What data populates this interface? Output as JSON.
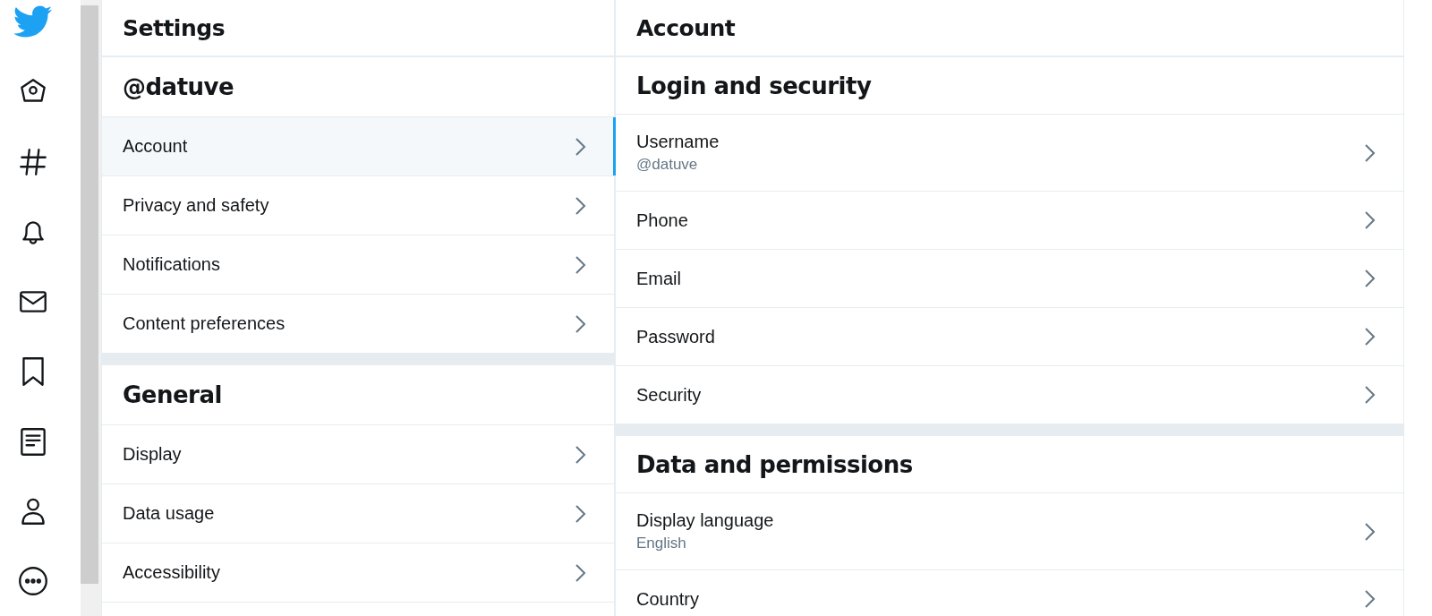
{
  "nav": {
    "items": [
      {
        "kind": "home"
      },
      {
        "kind": "explore"
      },
      {
        "kind": "notifications"
      },
      {
        "kind": "messages"
      },
      {
        "kind": "bookmarks"
      },
      {
        "kind": "lists"
      },
      {
        "kind": "profile"
      },
      {
        "kind": "more"
      }
    ]
  },
  "settings": {
    "title": "Settings",
    "sections": [
      {
        "heading": "@datuve",
        "items": [
          {
            "label": "Account",
            "selected": true
          },
          {
            "label": "Privacy and safety",
            "selected": false
          },
          {
            "label": "Notifications",
            "selected": false
          },
          {
            "label": "Content preferences",
            "selected": false
          }
        ]
      },
      {
        "heading": "General",
        "items": [
          {
            "label": "Display",
            "selected": false
          },
          {
            "label": "Data usage",
            "selected": false
          },
          {
            "label": "Accessibility",
            "selected": false
          }
        ]
      }
    ]
  },
  "account": {
    "title": "Account",
    "sections": [
      {
        "heading": "Login and security",
        "items": [
          {
            "label": "Username",
            "detail": "@datuve"
          },
          {
            "label": "Phone"
          },
          {
            "label": "Email"
          },
          {
            "label": "Password"
          },
          {
            "label": "Security"
          }
        ]
      },
      {
        "heading": "Data and permissions",
        "items": [
          {
            "label": "Display language",
            "detail": "English"
          },
          {
            "label": "Country"
          }
        ]
      }
    ]
  }
}
